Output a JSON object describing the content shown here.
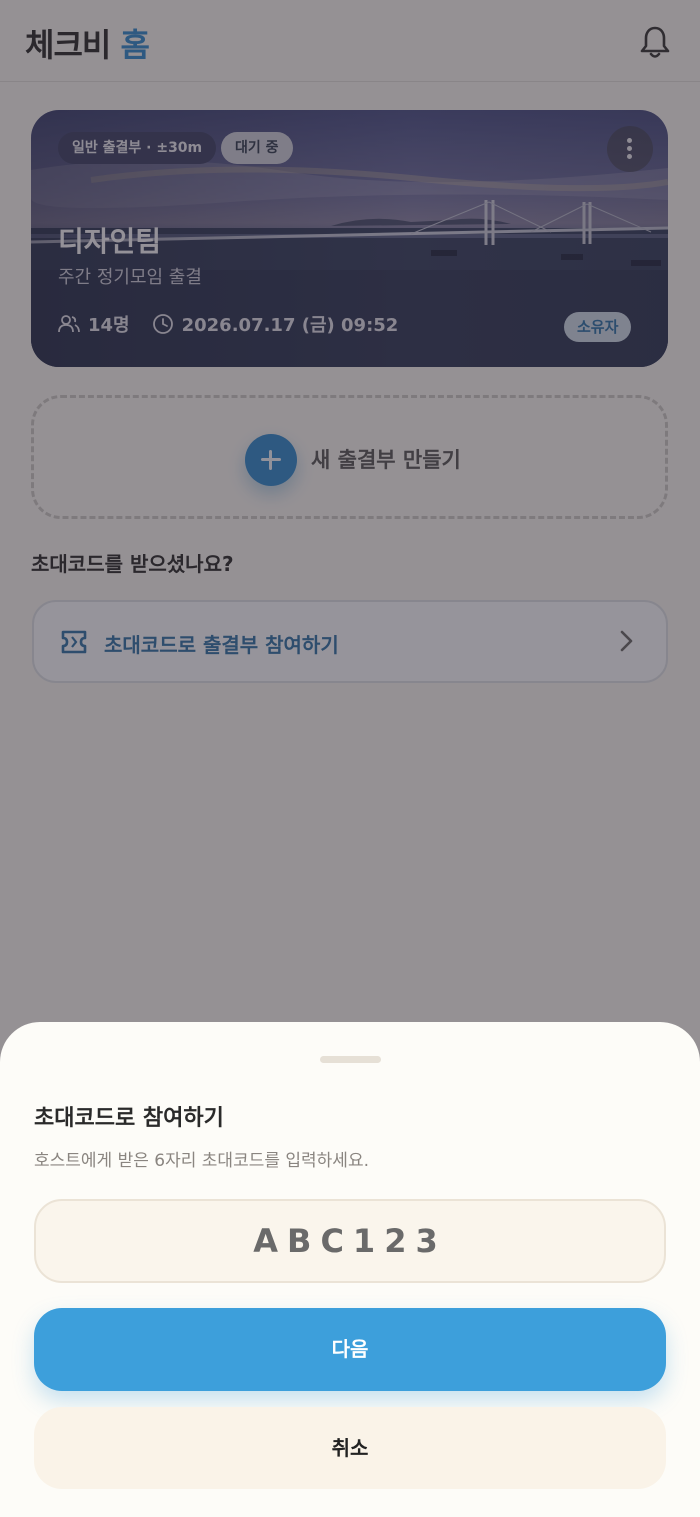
{
  "header": {
    "title_main": "체크비",
    "title_accent": "홈",
    "notification_icon": "bell-icon"
  },
  "card": {
    "type_label": "일반 출결부 · ±30m",
    "status_label": "대기 중",
    "title": "디자인팀",
    "subtitle": "주간 정기모임 출결",
    "members_count": "14명",
    "datetime": "2026.07.17 (금) 09:52",
    "role_badge": "소유자",
    "more_icon": "more-vertical-icon"
  },
  "create": {
    "label": "새 출결부 만들기",
    "icon": "plus-icon"
  },
  "invite": {
    "question": "초대코드를 받으셨나요?",
    "row_label": "초대코드로 출결부 참여하기",
    "icon": "ticket-icon"
  },
  "sheet": {
    "title": "초대코드로 참여하기",
    "description": "호스트에게 받은 6자리 초대코드를 입력하세요.",
    "code_value": "ABC123",
    "next_label": "다음",
    "cancel_label": "취소"
  },
  "colors": {
    "accent": "#2f86c9",
    "primary_button": "#3d9fdb",
    "sheet_background": "#fdfcf8"
  }
}
